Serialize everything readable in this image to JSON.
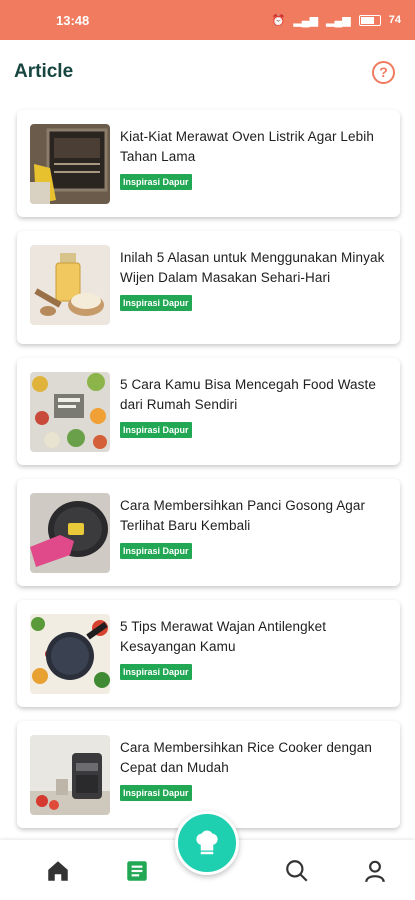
{
  "status_bar": {
    "time": "13:48",
    "battery_text": "74",
    "color": "#f07b5e"
  },
  "header": {
    "title": "Article",
    "help_icon": "question-circle-icon",
    "help_label": "?"
  },
  "articles": [
    {
      "title": "Kiat-Kiat Merawat Oven Listrik Agar Lebih Tahan Lama",
      "tag": "Inspirasi Dapur",
      "thumb": "oven"
    },
    {
      "title": "Inilah 5 Alasan untuk Menggunakan Minyak Wijen Dalam Masakan Sehari-Hari",
      "tag": "Inspirasi Dapur",
      "thumb": "sesame-oil"
    },
    {
      "title": "5 Cara Kamu Bisa Mencegah Food Waste dari Rumah Sendiri",
      "tag": "Inspirasi Dapur",
      "thumb": "groceries"
    },
    {
      "title": "Cara Membersihkan Panci Gosong Agar Terlihat Baru Kembali",
      "tag": "Inspirasi Dapur",
      "thumb": "cleaning-pan"
    },
    {
      "title": "5 Tips Merawat Wajan Antilengket Kesayangan Kamu",
      "tag": "Inspirasi Dapur",
      "thumb": "nonstick-pan"
    },
    {
      "title": "Cara Membersihkan Rice Cooker dengan Cepat dan Mudah",
      "tag": "Inspirasi Dapur",
      "thumb": "rice-cooker"
    }
  ],
  "bottom_nav": {
    "items": [
      "home-icon",
      "article-icon",
      "chef-hat-icon",
      "search-icon",
      "profile-icon"
    ],
    "active": "article-icon",
    "active_color": "#22a754",
    "fab_color": "#1ecfb0"
  }
}
